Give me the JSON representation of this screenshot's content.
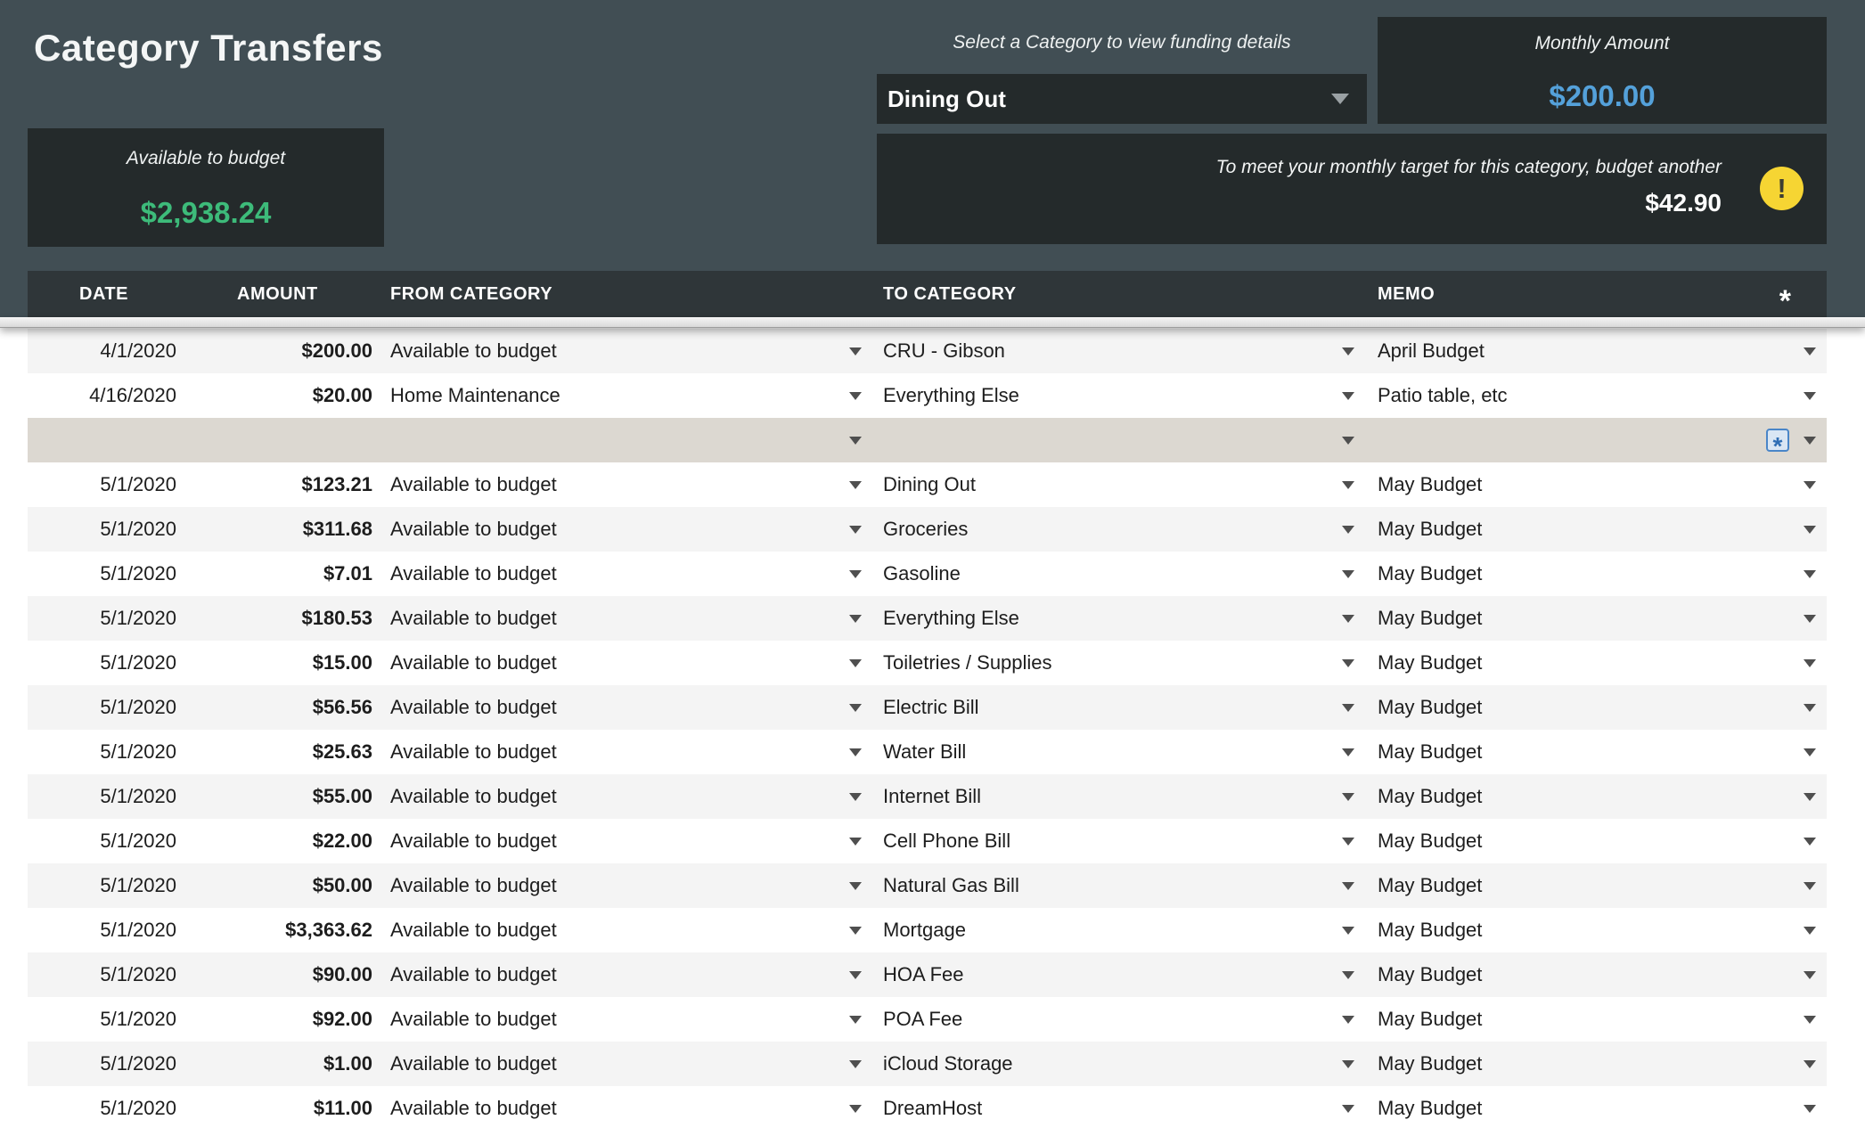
{
  "app": {
    "title": "Category Transfers"
  },
  "summary": {
    "available": {
      "label": "Available to budget",
      "value": "$2,938.24"
    },
    "category_picker": {
      "hint": "Select a Category to view funding details",
      "selected": "Dining Out"
    },
    "monthly": {
      "label": "Monthly Amount",
      "value": "$200.00"
    },
    "target": {
      "message": "To meet your monthly target for this category, budget another",
      "amount": "$42.90",
      "alert_icon": "!"
    }
  },
  "table": {
    "columns": [
      "DATE",
      "AMOUNT",
      "FROM CATEGORY",
      "TO CATEGORY",
      "MEMO"
    ],
    "header_icon": "*",
    "save_icon": "*",
    "rows": [
      {
        "kind": "shaded",
        "date": "4/1/2020",
        "amount": "$200.00",
        "from": "Available to budget",
        "to": "CRU - Gibson",
        "memo": "April Budget"
      },
      {
        "kind": "plain",
        "date": "4/16/2020",
        "amount": "$20.00",
        "from": "Home Maintenance",
        "to": "Everything Else",
        "memo": "Patio table, etc"
      },
      {
        "kind": "new",
        "date": "",
        "amount": "",
        "from": "",
        "to": "",
        "memo": ""
      },
      {
        "kind": "plain",
        "date": "5/1/2020",
        "amount": "$123.21",
        "from": "Available to budget",
        "to": "Dining Out",
        "memo": "May Budget"
      },
      {
        "kind": "shaded",
        "date": "5/1/2020",
        "amount": "$311.68",
        "from": "Available to budget",
        "to": "Groceries",
        "memo": "May Budget"
      },
      {
        "kind": "plain",
        "date": "5/1/2020",
        "amount": "$7.01",
        "from": "Available to budget",
        "to": "Gasoline",
        "memo": "May Budget"
      },
      {
        "kind": "shaded",
        "date": "5/1/2020",
        "amount": "$180.53",
        "from": "Available to budget",
        "to": "Everything Else",
        "memo": "May Budget"
      },
      {
        "kind": "plain",
        "date": "5/1/2020",
        "amount": "$15.00",
        "from": "Available to budget",
        "to": "Toiletries / Supplies",
        "memo": "May Budget"
      },
      {
        "kind": "shaded",
        "date": "5/1/2020",
        "amount": "$56.56",
        "from": "Available to budget",
        "to": "Electric Bill",
        "memo": "May Budget"
      },
      {
        "kind": "plain",
        "date": "5/1/2020",
        "amount": "$25.63",
        "from": "Available to budget",
        "to": "Water Bill",
        "memo": "May Budget"
      },
      {
        "kind": "shaded",
        "date": "5/1/2020",
        "amount": "$55.00",
        "from": "Available to budget",
        "to": "Internet Bill",
        "memo": "May Budget"
      },
      {
        "kind": "plain",
        "date": "5/1/2020",
        "amount": "$22.00",
        "from": "Available to budget",
        "to": "Cell Phone Bill",
        "memo": "May Budget"
      },
      {
        "kind": "shaded",
        "date": "5/1/2020",
        "amount": "$50.00",
        "from": "Available to budget",
        "to": "Natural Gas Bill",
        "memo": "May Budget"
      },
      {
        "kind": "plain",
        "date": "5/1/2020",
        "amount": "$3,363.62",
        "from": "Available to budget",
        "to": "Mortgage",
        "memo": "May Budget"
      },
      {
        "kind": "shaded",
        "date": "5/1/2020",
        "amount": "$90.00",
        "from": "Available to budget",
        "to": "HOA Fee",
        "memo": "May Budget"
      },
      {
        "kind": "plain",
        "date": "5/1/2020",
        "amount": "$92.00",
        "from": "Available to budget",
        "to": "POA Fee",
        "memo": "May Budget"
      },
      {
        "kind": "shaded",
        "date": "5/1/2020",
        "amount": "$1.00",
        "from": "Available to budget",
        "to": "iCloud Storage",
        "memo": "May Budget"
      },
      {
        "kind": "plain",
        "date": "5/1/2020",
        "amount": "$11.00",
        "from": "Available to budget",
        "to": "DreamHost",
        "memo": "May Budget"
      }
    ]
  },
  "colors": {
    "page_bg": "#414e54",
    "panel_bg": "#242a2b",
    "table_header_bg": "#2f3639",
    "available_green": "#3dbb7a",
    "monthly_blue": "#54a1da",
    "alert_yellow": "#f6d533",
    "new_row_bg": "#dcd8d1",
    "shaded_row_bg": "#f4f4f4"
  }
}
